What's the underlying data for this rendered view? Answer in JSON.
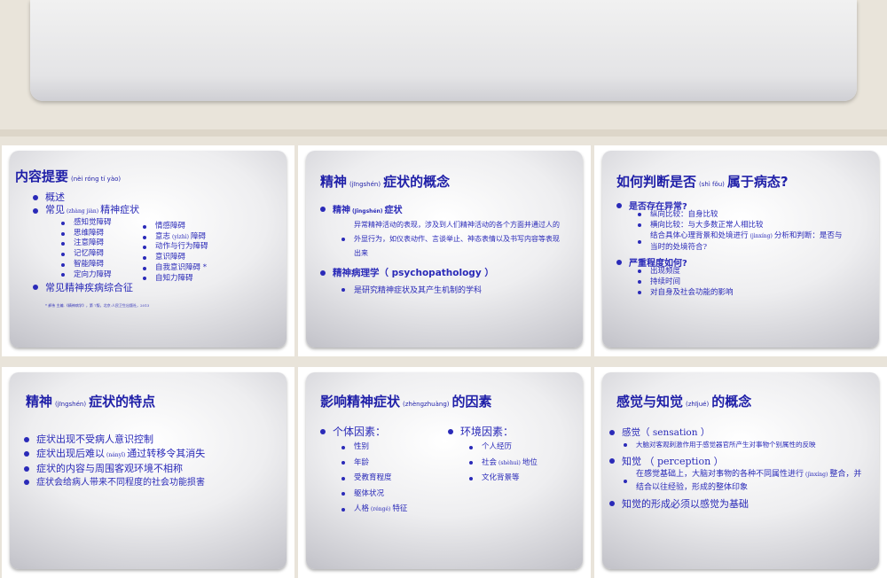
{
  "slides": {
    "s1": {
      "title": "内容提要",
      "title_ruby": "(nèi róng tí yào)",
      "items": [
        "概述",
        "常见",
        "精神症状",
        "常见精神疾病综合征"
      ],
      "item2_ruby": "(zhàng jiàn)",
      "col1": [
        "感知觉障碍",
        "思维障碍",
        "注意障碍",
        "记忆障碍",
        "智能障碍",
        "定向力障碍"
      ],
      "col2": [
        "情感障碍",
        "意志",
        "障碍",
        "动作与行为障碍",
        "意识障碍",
        "自我意识障碍 *",
        "自知力障碍"
      ],
      "col2_ruby": "(yìzhì)",
      "footnote": "* 郝伟 主编.《精神病学》，第 7版，北京:人民卫生出版社，2013"
    },
    "s2": {
      "title": "精神",
      "title_ruby": "(jīngshén)",
      "title_rest": "症状的概念",
      "h1": "精神",
      "h1_ruby": "(Jīngshén)",
      "h1_rest": "症状",
      "p1": "异常精神活动的表现，涉及到人们精神活动的各个方面并通过人的外显行为，如仪表动作、言谈举止、神态表情以及书写内容等表现出来",
      "h2": "精神病理学（ psychopathology ）",
      "p2": "是研究精神症状及其产生机制的学科"
    },
    "s3": {
      "title": "如何判断是否",
      "title_ruby": "(shì fǒu)",
      "title_rest": "属于病态?",
      "h1": "是否存在异常?",
      "sub1": [
        "纵向比较：自身比较",
        "横向比较：与大多数正常人相比较"
      ],
      "sub1c_a": "结合具体心理背景和处境进行",
      "sub1c_ruby": "(jìnxíng)",
      "sub1c_b": "分析和判断：是否与当时的处境符合?",
      "h2": "严重程度如何?",
      "sub2": [
        "出现频度",
        "持续时间",
        "对自身及社会功能的影响"
      ]
    },
    "s4": {
      "title": "精神",
      "title_ruby": "(jīngshén)",
      "title_rest": "症状的特点",
      "items": [
        "症状出现不受病人意识控制",
        "症状出现后难以",
        "通过转移令其消失",
        "症状的内容与周围客观环境不相称",
        "症状会给病人带来不同程度的社会功能损害"
      ],
      "item2_ruby": "(nányǐ)"
    },
    "s5": {
      "title": "影响精神症状",
      "title_ruby": "(zhèngzhuàng)",
      "title_rest": "的因素",
      "h1": "个体因素：",
      "list1": [
        "性别",
        "年龄",
        "受教育程度",
        "躯体状况",
        "人格",
        "特征"
      ],
      "list1_ruby": "(réngé)",
      "h2": "环境因素：",
      "list2": [
        "个人经历",
        "社会",
        "地位",
        "文化背景等"
      ],
      "list2_ruby": "(shèhuì)"
    },
    "s6": {
      "title": "感觉与知觉",
      "title_ruby": "(zhījué)",
      "title_rest": "的概念",
      "h1": "感觉（ sensation ）",
      "p1": "大脑对客观刺激作用于感觉器官所产生对事物个别属性的反映",
      "h2": "知觉 （ perception ）",
      "p2a": "在感觉基础上，大脑对事物的各种不同属性进行",
      "p2_ruby": "(jìnxíng)",
      "p2b": "整合，并结合以往经验，形成的整体印象",
      "h3": "知觉的形成必须以感觉为基础"
    }
  },
  "colors": {
    "text": "#2a2ab8",
    "title": "#1f1fa8",
    "background": "#e9e4da"
  }
}
